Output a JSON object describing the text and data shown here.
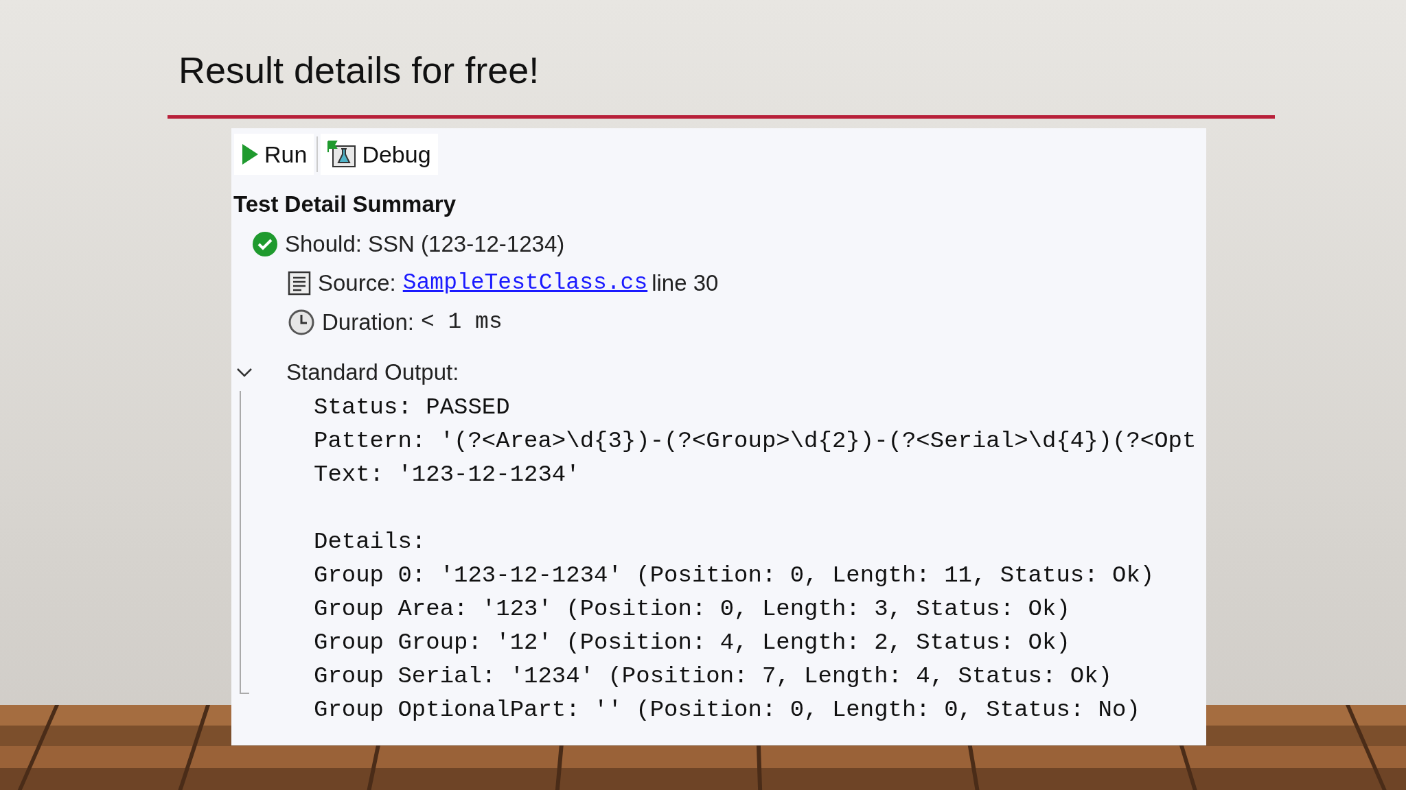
{
  "slide": {
    "title": "Result details for free!"
  },
  "toolbar": [
    {
      "kind": "run",
      "label": "Run"
    },
    {
      "kind": "debug",
      "label": "Debug"
    }
  ],
  "summary": {
    "heading": "Test Detail Summary",
    "test": {
      "name": "Should: SSN (123-12-1234)",
      "passed": true
    },
    "source": {
      "label": "Source:",
      "file": "SampleTestClass.cs",
      "line": "line 30"
    },
    "duration": {
      "label": "Duration:",
      "value": "< 1 ms"
    }
  },
  "output": {
    "heading": "Standard Output:",
    "expanded": true,
    "lines": [
      "Status: PASSED",
      "Pattern: '(?<Area>\\d{3})-(?<Group>\\d{2})-(?<Serial>\\d{4})(?<Opt",
      "Text: '123-12-1234'"
    ],
    "details": {
      "heading": "Details:",
      "lines": [
        "Group 0: '123-12-1234' (Position: 0, Length: 11, Status: Ok)",
        "Group Area: '123' (Position: 0, Length: 3, Status: Ok)",
        "Group Group: '12' (Position: 4, Length: 2, Status: Ok)",
        "Group Serial: '1234' (Position: 7, Length: 4, Status: Ok)",
        "Group OptionalPart: '' (Position: 0, Length: 0, Status: No)"
      ]
    }
  }
}
